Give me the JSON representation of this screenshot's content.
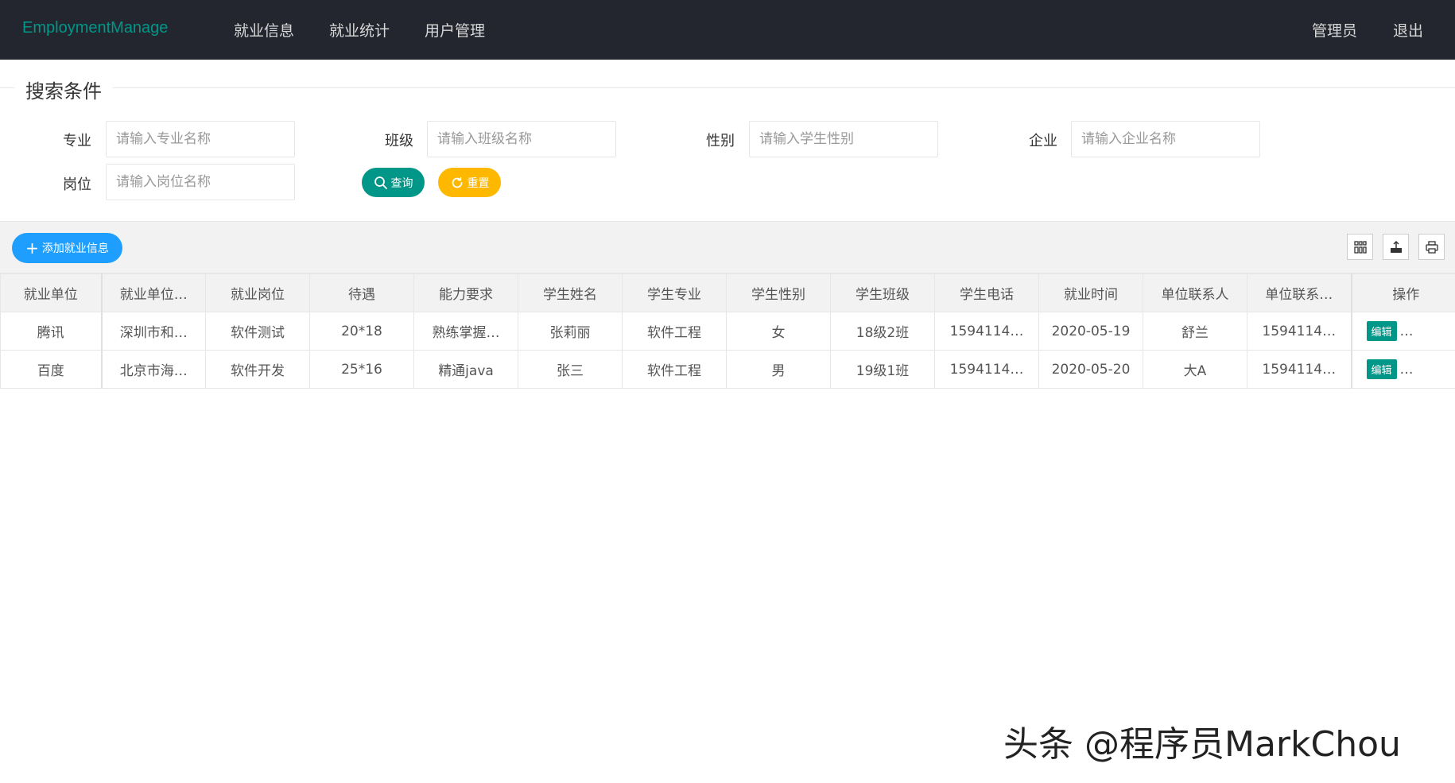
{
  "header": {
    "logo": "EmploymentManage",
    "nav": [
      "就业信息",
      "就业统计",
      "用户管理"
    ],
    "user": "管理员",
    "logout": "退出"
  },
  "search": {
    "legend": "搜索条件",
    "fields": [
      {
        "label": "专业",
        "placeholder": "请输入专业名称"
      },
      {
        "label": "班级",
        "placeholder": "请输入班级名称"
      },
      {
        "label": "性别",
        "placeholder": "请输入学生性别"
      },
      {
        "label": "企业",
        "placeholder": "请输入企业名称"
      },
      {
        "label": "岗位",
        "placeholder": "请输入岗位名称"
      }
    ],
    "query_label": "查询",
    "reset_label": "重置"
  },
  "toolbar": {
    "add_label": "添加就业信息"
  },
  "table": {
    "columns": [
      "就业单位",
      "就业单位…",
      "就业岗位",
      "待遇",
      "能力要求",
      "学生姓名",
      "学生专业",
      "学生性别",
      "学生班级",
      "学生电话",
      "就业时间",
      "单位联系人",
      "单位联系…",
      "操作"
    ],
    "rows": [
      [
        "腾讯",
        "深圳市和…",
        "软件测试",
        "20*18",
        "熟练掌握…",
        "张莉丽",
        "软件工程",
        "女",
        "18级2班",
        "1594114…",
        "2020-05-19",
        "舒兰",
        "1594114…"
      ],
      [
        "百度",
        "北京市海…",
        "软件开发",
        "25*16",
        "精通java",
        "张三",
        "软件工程",
        "男",
        "19级1班",
        "1594114…",
        "2020-05-20",
        "大A",
        "1594114…"
      ]
    ],
    "edit_label": "编辑",
    "more_label": "…"
  },
  "watermark": "头条 @程序员MarkChou",
  "colors": {
    "header_bg": "#23262e",
    "logo": "#009688",
    "query": "#009688",
    "reset": "#ffb800",
    "add": "#1e9fff"
  }
}
